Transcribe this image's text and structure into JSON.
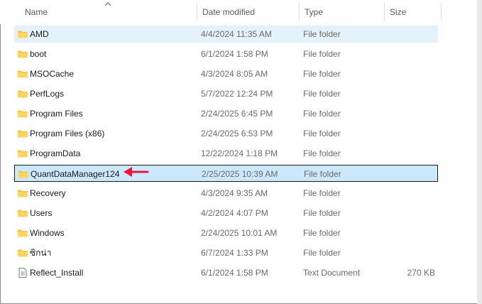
{
  "columns": {
    "name": "Name",
    "date": "Date modified",
    "type": "Type",
    "size": "Size"
  },
  "colors": {
    "folder": "#f8c43a",
    "selection_bg": "#cce8ff",
    "hover_bg": "#e5f1fb",
    "annotation_arrow": "#e8143c"
  },
  "rows": [
    {
      "name": "AMD",
      "date": "4/4/2024 11:35 AM",
      "type": "File folder",
      "size": "",
      "icon": "folder-icon",
      "state": "highlight"
    },
    {
      "name": "boot",
      "date": "6/1/2024 1:58 PM",
      "type": "File folder",
      "size": "",
      "icon": "folder-icon"
    },
    {
      "name": "MSOCache",
      "date": "4/3/2024 8:05 AM",
      "type": "File folder",
      "size": "",
      "icon": "folder-icon"
    },
    {
      "name": "PerfLogs",
      "date": "5/7/2022 12:24 PM",
      "type": "File folder",
      "size": "",
      "icon": "folder-icon"
    },
    {
      "name": "Program Files",
      "date": "2/24/2025 6:45 PM",
      "type": "File folder",
      "size": "",
      "icon": "folder-icon"
    },
    {
      "name": "Program Files (x86)",
      "date": "2/24/2025 6:53 PM",
      "type": "File folder",
      "size": "",
      "icon": "folder-icon"
    },
    {
      "name": "ProgramData",
      "date": "12/22/2024 1:18 PM",
      "type": "File folder",
      "size": "",
      "icon": "folder-icon"
    },
    {
      "name": "QuantDataManager124",
      "date": "2/25/2025 10:39 AM",
      "type": "File folder",
      "size": "",
      "icon": "folder-icon",
      "state": "selected"
    },
    {
      "name": "Recovery",
      "date": "4/3/2024 9:35 AM",
      "type": "File folder",
      "size": "",
      "icon": "folder-icon"
    },
    {
      "name": "Users",
      "date": "4/2/2024 4:07 PM",
      "type": "File folder",
      "size": "",
      "icon": "folder-icon"
    },
    {
      "name": "Windows",
      "date": "2/24/2025 10:01 AM",
      "type": "File folder",
      "size": "",
      "icon": "folder-icon"
    },
    {
      "name": "ซิกน่า",
      "date": "6/7/2024 1:33 PM",
      "type": "File folder",
      "size": "",
      "icon": "folder-icon"
    },
    {
      "name": "Reflect_Install",
      "date": "6/1/2024 1:58 PM",
      "type": "Text Document",
      "size": "270 KB",
      "icon": "text-document-icon"
    }
  ]
}
